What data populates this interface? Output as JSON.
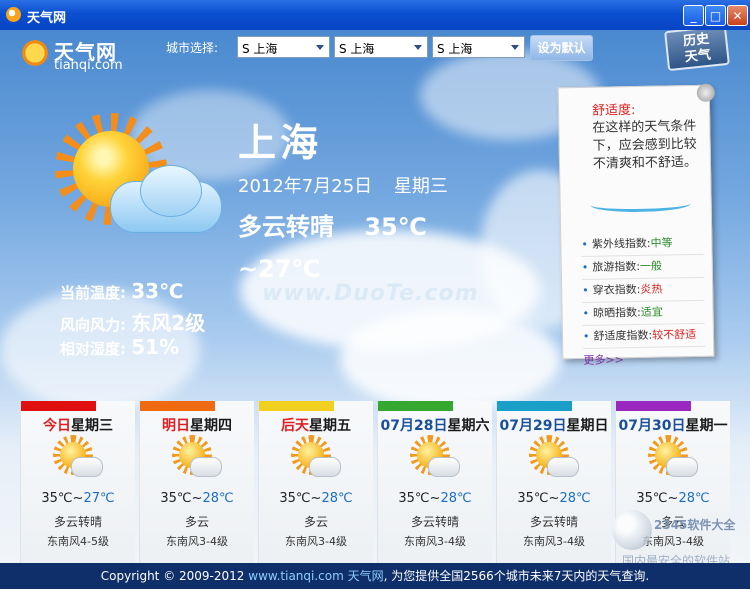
{
  "window": {
    "title": "天气网"
  },
  "logo": {
    "brand": "天气网",
    "domain": "tianqi.com"
  },
  "city_selector": {
    "label": "城市选择:",
    "selects": [
      {
        "value": "S 上海"
      },
      {
        "value": "S 上海"
      },
      {
        "value": "S 上海"
      }
    ],
    "default_button": "设为默认"
  },
  "history_button": {
    "line1": "历史",
    "line2": "天气"
  },
  "current": {
    "city": "上海",
    "date": "2012年7月25日",
    "weekday": "星期三",
    "condition": "多云转晴",
    "high": "35℃",
    "low": "~27℃",
    "stats": [
      {
        "label": "当前温度:",
        "value": "33℃"
      },
      {
        "label": "风向风力:",
        "value": "东风2级"
      },
      {
        "label": "相对湿度:",
        "value": "51%"
      }
    ]
  },
  "watermark": "www.DuoTe.com",
  "comfort_panel": {
    "title": "舒适度:",
    "text": "在这样的天气条件下，应会感到比较不清爽和不舒适。",
    "indices": [
      {
        "label": "紫外线指数:",
        "value": "中等",
        "color": "#2b8a2b"
      },
      {
        "label": "旅游指数:",
        "value": "一般",
        "color": "#2b8a2b"
      },
      {
        "label": "穿衣指数:",
        "value": "炎热",
        "color": "#e02020"
      },
      {
        "label": "晾晒指数:",
        "value": "适宜",
        "color": "#2b8a2b"
      },
      {
        "label": "舒适度指数:",
        "value": "较不舒适",
        "color": "#e02020"
      }
    ],
    "more": "更多>>"
  },
  "forecast": [
    {
      "prefix": "今日",
      "rest": "星期三",
      "prefix_color": "#e02020",
      "bar_color": "#e01010",
      "hi": "35℃",
      "lo": "27℃",
      "desc": "多云转晴",
      "wind": "东南风4-5级",
      "icon": "partly-cloudy-icon"
    },
    {
      "prefix": "明日",
      "rest": "星期四",
      "prefix_color": "#e02020",
      "bar_color": "#ef6a10",
      "hi": "35℃",
      "lo": "28℃",
      "desc": "多云",
      "wind": "东南风3-4级",
      "icon": "partly-cloudy-icon"
    },
    {
      "prefix": "后天",
      "rest": "星期五",
      "prefix_color": "#e02020",
      "bar_color": "#f2d020",
      "hi": "35℃",
      "lo": "28℃",
      "desc": "多云",
      "wind": "东南风3-4级",
      "icon": "partly-cloudy-icon"
    },
    {
      "prefix": "07月28日",
      "rest": "星期六",
      "prefix_color": "#1a4f9c",
      "bar_color": "#35a830",
      "hi": "35℃",
      "lo": "28℃",
      "desc": "多云转晴",
      "wind": "东南风3-4级",
      "icon": "partly-cloudy-icon"
    },
    {
      "prefix": "07月29日",
      "rest": "星期日",
      "prefix_color": "#1a4f9c",
      "bar_color": "#1aa0c8",
      "hi": "35℃",
      "lo": "28℃",
      "desc": "多云转晴",
      "wind": "东南风3-4级",
      "icon": "partly-cloudy-icon"
    },
    {
      "prefix": "07月30日",
      "rest": "星期一",
      "prefix_color": "#1a4f9c",
      "bar_color": "#9a28c0",
      "hi": "35℃",
      "lo": "28℃",
      "desc": "多云",
      "wind": "东南风3-4级",
      "icon": "partly-cloudy-icon"
    }
  ],
  "corner_logo": {
    "name": "2345软件大全",
    "slogan": "国内最安全的软件站"
  },
  "footer": {
    "prefix": "Copyright © 2009-2012 ",
    "link": "www.tianqi.com 天气网",
    "suffix": ", 为您提供全国2566个城市未来7天内的天气查询."
  }
}
